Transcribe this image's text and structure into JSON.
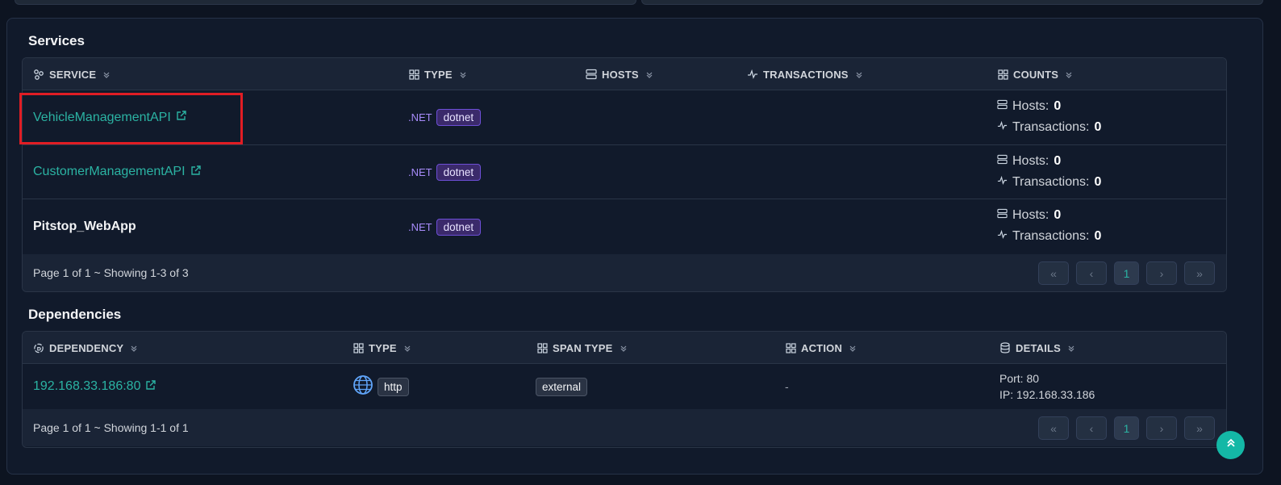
{
  "services": {
    "title": "Services",
    "columns": {
      "service": "SERVICE",
      "type": "TYPE",
      "hosts": "HOSTS",
      "transactions": "TRANSACTIONS",
      "counts": "COUNTS"
    },
    "rows": [
      {
        "name": "VehicleManagementAPI",
        "lang": ".NET",
        "badge": "dotnet",
        "hosts_label": "Hosts:",
        "hosts": "0",
        "tx_label": "Transactions:",
        "tx": "0"
      },
      {
        "name": "CustomerManagementAPI",
        "lang": ".NET",
        "badge": "dotnet",
        "hosts_label": "Hosts:",
        "hosts": "0",
        "tx_label": "Transactions:",
        "tx": "0"
      },
      {
        "name": "Pitstop_WebApp",
        "lang": ".NET",
        "badge": "dotnet",
        "hosts_label": "Hosts:",
        "hosts": "0",
        "tx_label": "Transactions:",
        "tx": "0"
      }
    ],
    "footer": "Page 1 of 1 ~ Showing 1-3 of 3",
    "page": "1"
  },
  "dependencies": {
    "title": "Dependencies",
    "columns": {
      "dependency": "DEPENDENCY",
      "type": "TYPE",
      "span_type": "SPAN TYPE",
      "action": "ACTION",
      "details": "DETAILS"
    },
    "rows": [
      {
        "name": "192.168.33.186:80",
        "type": "http",
        "span_type": "external",
        "action": "-",
        "port": "Port: 80",
        "ip": "IP: 192.168.33.186"
      }
    ],
    "footer": "Page 1 of 1 ~ Showing 1-1 of 1",
    "page": "1"
  },
  "pager_glyphs": {
    "first": "«",
    "prev": "‹",
    "next": "›",
    "last": "»"
  },
  "colors": {
    "accent": "#2bb3a3",
    "highlight": "#e11d24",
    "badge": "#3b2a6b"
  }
}
